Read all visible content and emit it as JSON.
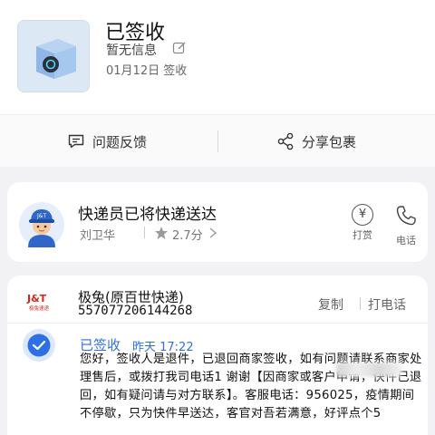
{
  "package": {
    "title": "已签收",
    "subtitle": "暂无信息",
    "sign_date": "01月12日 签收"
  },
  "actions": {
    "feedback_label": "问题反馈",
    "share_label": "分享包裹"
  },
  "courier": {
    "status_text": "快递员已将快递送达",
    "name": "刘卫华",
    "rating": "2.7分",
    "tip_label": "打赏",
    "phone_label": "电话"
  },
  "logistics": {
    "company": "极兔(原百世快递)",
    "tracking_number": "557077206144268",
    "copy_label": "复制",
    "call_label": "打电话",
    "logo_text": "J&T",
    "logo_subtext": "极兔速递",
    "event": {
      "status": "已签收",
      "time": "昨天 17:22",
      "text": "您好，签收人是退件，已退回商家签收，如有问题请联系商家处理售后，或拨打我司电话1           谢谢【因商家或客户申请，快件已退回，如有疑问请与对方联系】。客服电话：956025，疫情期间不停歇，只为快件早送达，客官对吾若满意，好评点个5"
    }
  },
  "colors": {
    "accent": "#2f6fe6",
    "logo_red": "#d6261c"
  }
}
